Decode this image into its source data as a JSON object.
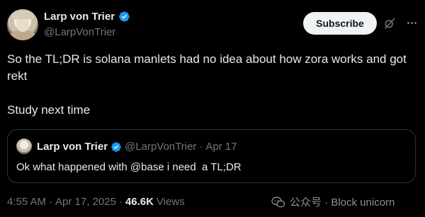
{
  "author": {
    "display_name": "Larp von Trier",
    "handle": "@LarpVonTrier"
  },
  "actions": {
    "subscribe_label": "Subscribe",
    "grok_icon": "grok-slash-icon",
    "more_icon": "more-dots-icon"
  },
  "tweet": {
    "line1": "So the TL;DR is solana manlets had no idea about how zora works and got rekt",
    "line2": "Study next time"
  },
  "quote": {
    "display_name": "Larp von Trier",
    "handle": "@LarpVonTrier",
    "separator": "·",
    "date": "Apr 17",
    "text": "Ok what happened with @base i need  a TL;DR"
  },
  "meta": {
    "time": "4:55 AM",
    "separator": "·",
    "date": "Apr 17, 2025",
    "separator2": "·",
    "views_count": "46.6K",
    "views_label": "Views"
  },
  "watermark": {
    "text": "公众号 · Block unicorn"
  },
  "colors": {
    "background": "#000000",
    "verified": "#1d9bf0",
    "secondary_text": "#71767b",
    "subscribe_bg": "#eff3f4"
  }
}
